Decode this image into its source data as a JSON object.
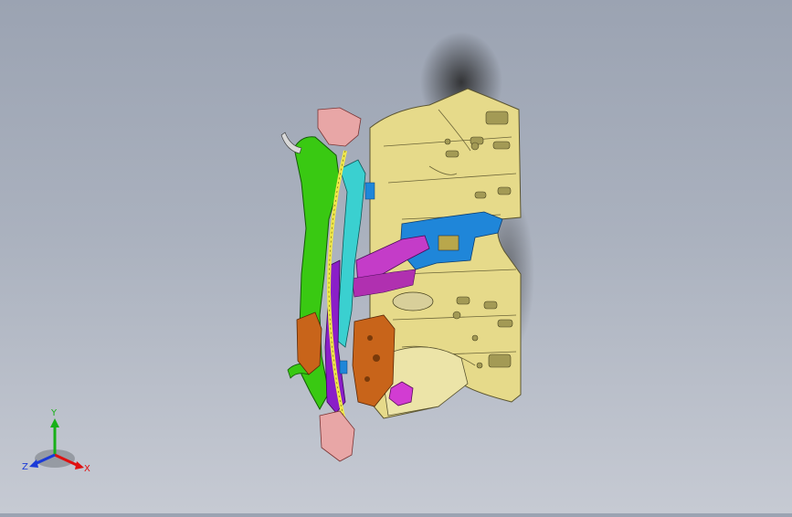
{
  "viewport": {
    "background_top": "#9ba3b2",
    "background_bottom": "#c6cad3",
    "model_colors": {
      "floor_panel": "#e6da8a",
      "side_member": "#39c912",
      "sill_inner": "#3ad0d0",
      "crossmember_purple": "#8a1ec8",
      "bracket_blue": "#1f86d9",
      "bracket_orange": "#c8641a",
      "bracket_pink": "#e8a6a6",
      "yellow_rail": "#f0e84a",
      "magenta_part": "#d23cd2"
    }
  },
  "triad": {
    "x_label": "X",
    "y_label": "Y",
    "z_label": "Z",
    "x_color": "#e01010",
    "y_color": "#18b018",
    "z_color": "#1a3ad8"
  }
}
